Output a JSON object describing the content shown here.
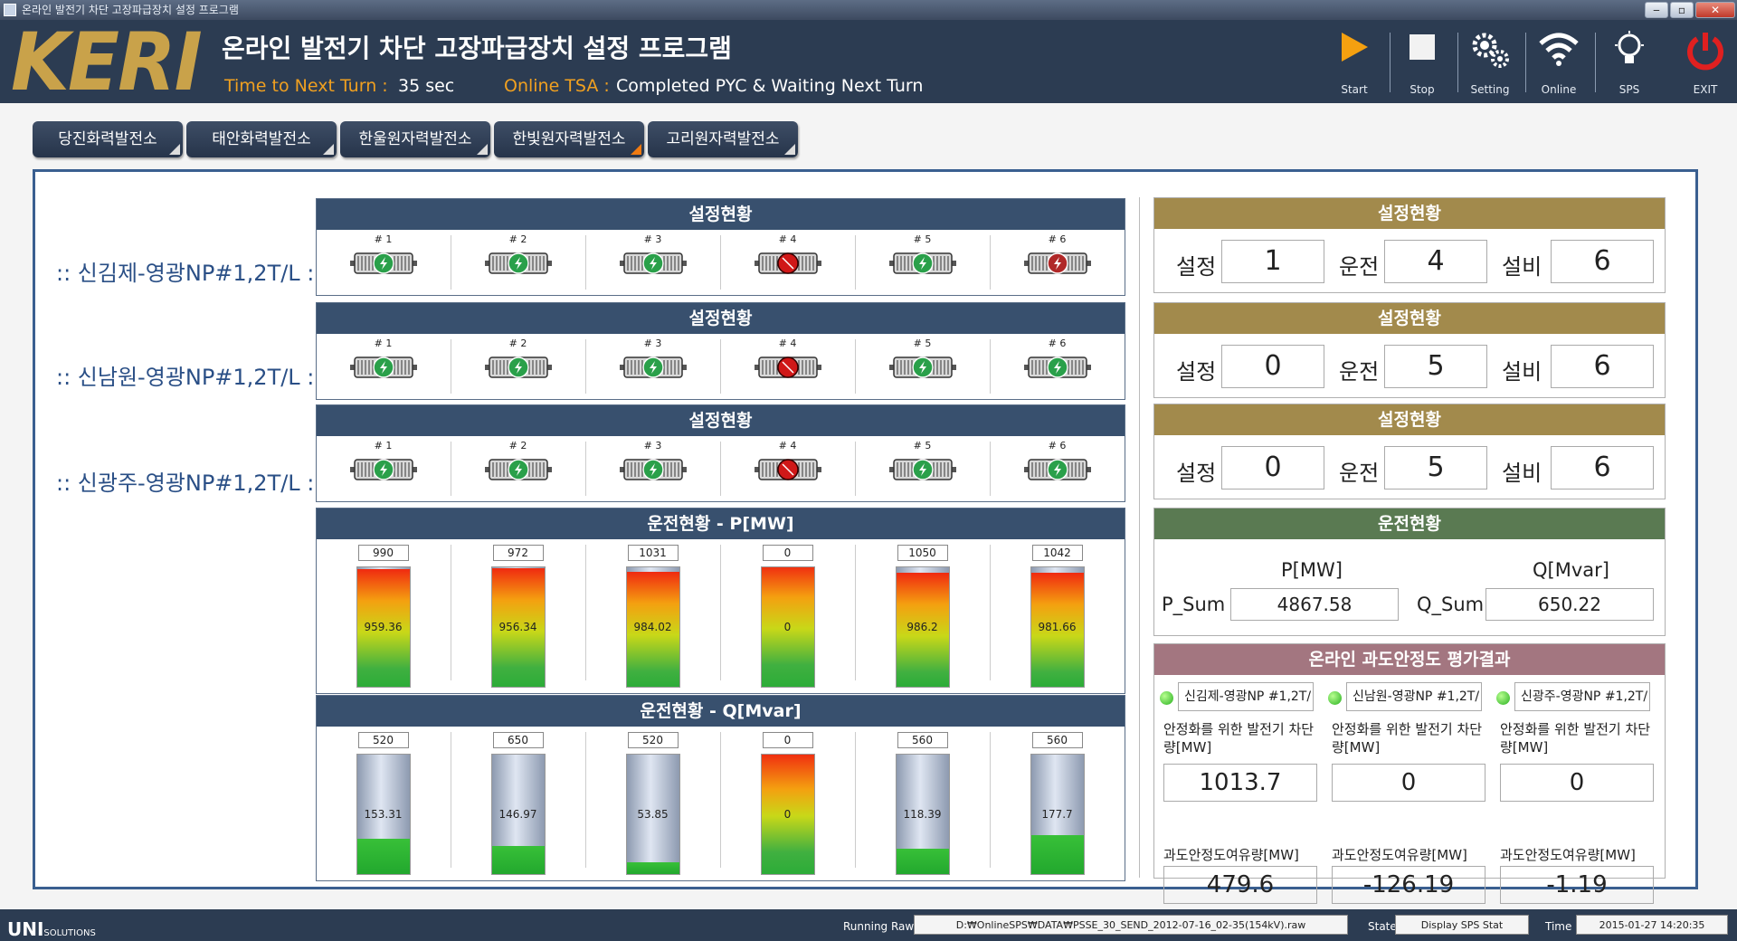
{
  "window": {
    "title": "온라인 발전기 차단 고장파급장치 설정 프로그램",
    "min": "‒",
    "max": "▫",
    "close": "✕"
  },
  "header": {
    "logo": "KERI",
    "title": "온라인 발전기 차단 고장파급장치 설정 프로그램",
    "next_turn_label": "Time to Next Turn :",
    "next_turn_value": "35 sec",
    "tsa_label": "Online TSA :",
    "tsa_value": "Completed PYC & Waiting Next Turn",
    "toolbar": [
      {
        "label": "Start",
        "icon": "play-icon"
      },
      {
        "label": "Stop",
        "icon": "stop-icon"
      },
      {
        "label": "Setting",
        "icon": "gear-icon"
      },
      {
        "label": "Online",
        "icon": "wifi-icon"
      },
      {
        "label": "SPS",
        "icon": "bulb-icon"
      },
      {
        "label": "EXIT",
        "icon": "power-icon"
      }
    ]
  },
  "plant_tabs": [
    "당진화력발전소",
    "태안화력발전소",
    "한울원자력발전소",
    "한빛원자력발전소",
    "고리원자력발전소"
  ],
  "lines": [
    {
      "label": ":: 신김제-영광NP#1,2T/L ::",
      "header": "설정현황",
      "units": [
        "# 1",
        "# 2",
        "# 3",
        "# 4",
        "# 5",
        "# 6"
      ],
      "states": [
        "on",
        "on",
        "on",
        "trip",
        "on",
        "off"
      ]
    },
    {
      "label": ":: 신남원-영광NP#1,2T/L ::",
      "header": "설정현황",
      "units": [
        "# 1",
        "# 2",
        "# 3",
        "# 4",
        "# 5",
        "# 6"
      ],
      "states": [
        "on",
        "on",
        "on",
        "trip",
        "on",
        "on"
      ]
    },
    {
      "label": ":: 신광주-영광NP#1,2T/L ::",
      "header": "설정현황",
      "units": [
        "# 1",
        "# 2",
        "# 3",
        "# 4",
        "# 5",
        "# 6"
      ],
      "states": [
        "on",
        "on",
        "on",
        "trip",
        "on",
        "on"
      ]
    }
  ],
  "power_p": {
    "header": "운전현황 - P[MW]",
    "max": [
      "990",
      "972",
      "1031",
      "0",
      "1050",
      "1042"
    ],
    "values": [
      "959.36",
      "956.34",
      "984.02",
      "0",
      "986.2",
      "981.66"
    ],
    "fill": [
      0.97,
      0.98,
      0.95,
      1.0,
      0.94,
      0.94
    ]
  },
  "power_q": {
    "header": "운전현황 - Q[Mvar]",
    "max": [
      "520",
      "650",
      "520",
      "0",
      "560",
      "560"
    ],
    "values": [
      "153.31",
      "146.97",
      "53.85",
      "0",
      "118.39",
      "177.7"
    ],
    "fill": [
      0.29,
      0.23,
      0.1,
      1.0,
      0.21,
      0.32
    ]
  },
  "settings": [
    {
      "header": "설정현황",
      "set_label": "설정",
      "set": "1",
      "run_label": "운전",
      "run": "4",
      "equip_label": "설비",
      "equip": "6"
    },
    {
      "header": "설정현황",
      "set_label": "설정",
      "set": "0",
      "run_label": "운전",
      "run": "5",
      "equip_label": "설비",
      "equip": "6"
    },
    {
      "header": "설정현황",
      "set_label": "설정",
      "set": "0",
      "run_label": "운전",
      "run": "5",
      "equip_label": "설비",
      "equip": "6"
    }
  ],
  "operation": {
    "header": "운전현황",
    "p_unit": "P[MW]",
    "q_unit": "Q[Mvar]",
    "p_sum_label": "P_Sum",
    "p_sum": "4867.58",
    "q_sum_label": "Q_Sum",
    "q_sum": "650.22"
  },
  "tsa": {
    "header": "온라인 과도안정도 평가결과",
    "cols": [
      {
        "name": "신김제-영광NP #1,2T/",
        "desc": "안정화를 위한 발전기 차단량[MW]",
        "trip": "1013.7",
        "margin_label": "과도안정도여유량[MW]",
        "margin": "479.6"
      },
      {
        "name": "신남원-영광NP #1,2T/",
        "desc": "안정화를 위한 발전기 차단량[MW]",
        "trip": "0",
        "margin_label": "과도안정도여유량[MW]",
        "margin": "-126.19"
      },
      {
        "name": "신광주-영광NP #1,2T/",
        "desc": "안정화를 위한 발전기 차단량[MW]",
        "trip": "0",
        "margin_label": "과도안정도여유량[MW]",
        "margin": "-1.19"
      }
    ]
  },
  "status": {
    "brand": "UNI",
    "brand_sub": "SOLUTIONS",
    "raw_label": "Running Raw",
    "raw_value": "D:₩OnlineSPS₩DATA₩PSSE_30_SEND_2012-07-16_02-35(154kV).raw",
    "state_label": "State",
    "state_value": "Display SPS Stat",
    "time_label": "Time",
    "time_value": "2015-01-27  14:20:35"
  },
  "colors": {
    "header_bg": "#2c3c52",
    "accent": "#f0a020",
    "logo": "#c9a24a",
    "gen_on": "#2aa04a",
    "gen_trip": "#d01818",
    "gen_off": "#b02828"
  }
}
